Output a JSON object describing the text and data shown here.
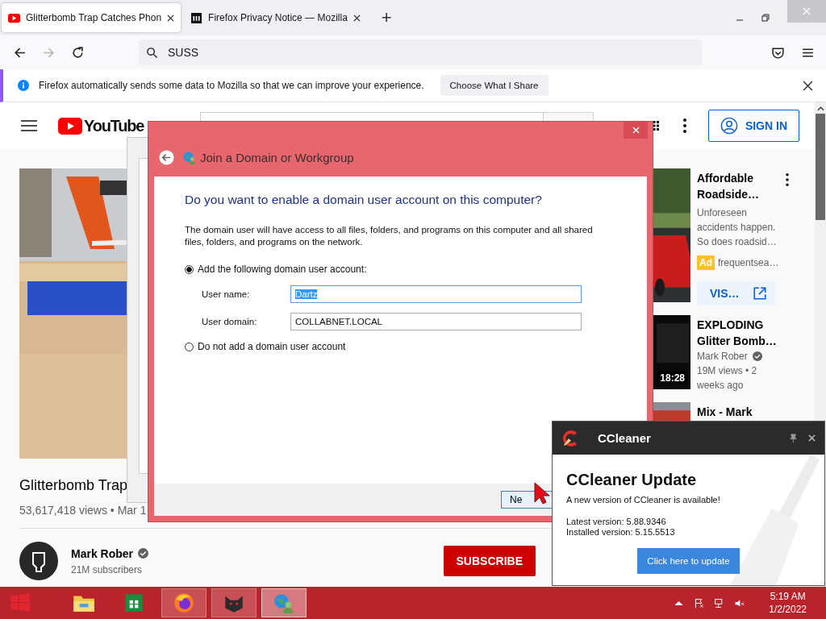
{
  "browser": {
    "tabs": [
      {
        "title": "Glitterbomb Trap Catches Phon",
        "kind": "youtube",
        "selected": true
      },
      {
        "title": "Firefox Privacy Notice — Mozilla",
        "kind": "mozilla",
        "selected": false
      }
    ],
    "new_tab": "+",
    "forward": {
      "disabled": true
    },
    "address_bar": {
      "value": "SUSS"
    },
    "notification": {
      "text": "Firefox automatically sends some data to Mozilla so that we can improve your experience.",
      "button": "Choose What I Share"
    }
  },
  "youtube": {
    "logo": "YouTube",
    "sign_in": "SIGN IN",
    "video": {
      "title": "Glitterbomb Trap",
      "meta": "53,617,418 views • Mar 1"
    },
    "channel": {
      "name": "Mark Rober",
      "verified": true,
      "subscribers": "21M subscribers"
    },
    "subscribe": "SUBSCRIBE",
    "sidebar": [
      {
        "kind": "ad",
        "title": "Affordable Roadside…",
        "description": "Unforeseen accidents happen. So does roadsid…",
        "ad_label": "Ad",
        "advertiser": "frequentsea…",
        "button": "VIS…"
      },
      {
        "kind": "video",
        "title": "EXPLODING Glitter Bomb…",
        "channel": "Mark Rober",
        "verified": true,
        "meta": "19M views • 2 weeks ago",
        "duration": "18:28"
      },
      {
        "kind": "video",
        "title": "Mix - Mark"
      }
    ]
  },
  "dialog": {
    "title": "Join a Domain or Workgroup",
    "heading": "Do you want to enable a domain user account on this computer?",
    "body": "The domain user will have access to all files, folders, and programs on this computer and all shared files, folders, and programs on the network.",
    "radios": [
      {
        "label": "Add the following domain user account:",
        "selected": true
      },
      {
        "label": "Do not add a domain user account",
        "selected": false
      }
    ],
    "fields": [
      {
        "label": "User name:",
        "value": "Dartz",
        "focused": true
      },
      {
        "label": "User domain:",
        "value": "COLLABNET.LOCAL",
        "focused": false
      }
    ],
    "button": "Ne"
  },
  "ccleaner": {
    "title": "CCleaner",
    "heading": "CCleaner Update",
    "message": "A new version of CCleaner is available!",
    "latest": "Latest version: 5.88.9346",
    "installed": "Installed version: 5.15.5513",
    "button": "Click here to update"
  },
  "taskbar": {
    "apps": [
      {
        "kind": "explorer",
        "running": false,
        "selected": false
      },
      {
        "kind": "store",
        "running": false,
        "selected": false
      },
      {
        "kind": "firefox",
        "running": true,
        "selected": false
      },
      {
        "kind": "cat",
        "running": true,
        "selected": false
      },
      {
        "kind": "network",
        "running": true,
        "selected": true
      }
    ],
    "clock": {
      "time": "5:19 AM",
      "date": "1/2/2022"
    }
  }
}
